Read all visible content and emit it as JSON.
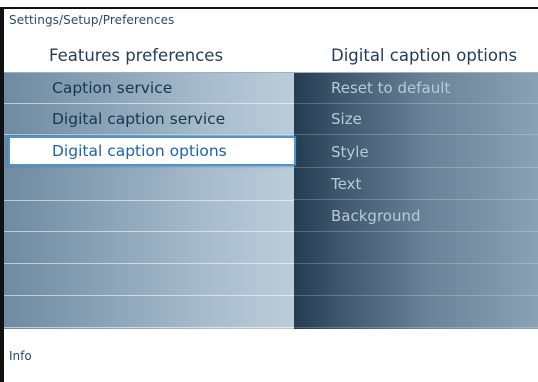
{
  "breadcrumb": "Settings/Setup/Preferences",
  "header": {
    "left_title": "Features preferences",
    "right_title": "Digital caption options"
  },
  "left_menu": {
    "items": [
      {
        "label": "Caption service"
      },
      {
        "label": "Digital caption service"
      },
      {
        "label": "Digital caption options",
        "selected": true
      },
      {
        "label": ""
      },
      {
        "label": ""
      },
      {
        "label": ""
      },
      {
        "label": ""
      },
      {
        "label": ""
      }
    ]
  },
  "right_menu": {
    "items": [
      {
        "label": "Reset to default"
      },
      {
        "label": "Size"
      },
      {
        "label": "Style"
      },
      {
        "label": "Text"
      },
      {
        "label": "Background"
      },
      {
        "label": ""
      },
      {
        "label": ""
      },
      {
        "label": ""
      }
    ]
  },
  "footer": {
    "info_label": "Info"
  },
  "colors": {
    "selection_border": "#4f93c7",
    "selected_text": "#1c63a8",
    "header_text": "#1f3c5c"
  }
}
